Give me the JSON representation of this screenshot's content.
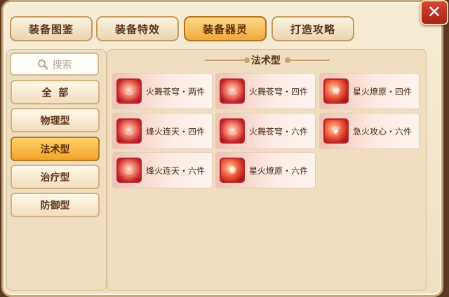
{
  "tabs": [
    {
      "label": "装备图鉴",
      "active": false
    },
    {
      "label": "装备特效",
      "active": false
    },
    {
      "label": "装备器灵",
      "active": true
    },
    {
      "label": "打造攻略",
      "active": false
    }
  ],
  "close_label": "✕",
  "search": {
    "placeholder": "搜索",
    "icon": "search-icon"
  },
  "categories": [
    {
      "label": "全  部",
      "active": false
    },
    {
      "label": "物理型",
      "active": false
    },
    {
      "label": "法术型",
      "active": true
    },
    {
      "label": "治疗型",
      "active": false
    },
    {
      "label": "防御型",
      "active": false
    }
  ],
  "panel_title": "法术型",
  "items": [
    {
      "label": "火舞苍穹・两件",
      "icon": "flame-spirit-icon",
      "glyph": "♨"
    },
    {
      "label": "火舞苍穹・四件",
      "icon": "flame-spirit-icon",
      "glyph": "♨"
    },
    {
      "label": "星火燎原・四件",
      "icon": "fire-swirl-icon",
      "glyph": "✺"
    },
    {
      "label": "烽火连天・四件",
      "icon": "flame-spirit-icon",
      "glyph": "♨"
    },
    {
      "label": "火舞苍穹・六件",
      "icon": "flame-spirit-icon",
      "glyph": "♨"
    },
    {
      "label": "急火攻心・六件",
      "icon": "fire-heart-icon",
      "glyph": "❦"
    },
    {
      "label": "烽火连天・六件",
      "icon": "flame-spirit-icon",
      "glyph": "♨"
    },
    {
      "label": "星火燎原・六件",
      "icon": "fire-swirl-icon",
      "glyph": "✺"
    }
  ],
  "colors": {
    "accent": "#f0a93e",
    "card_red": "#c4242a",
    "close_red": "#c4331f"
  }
}
